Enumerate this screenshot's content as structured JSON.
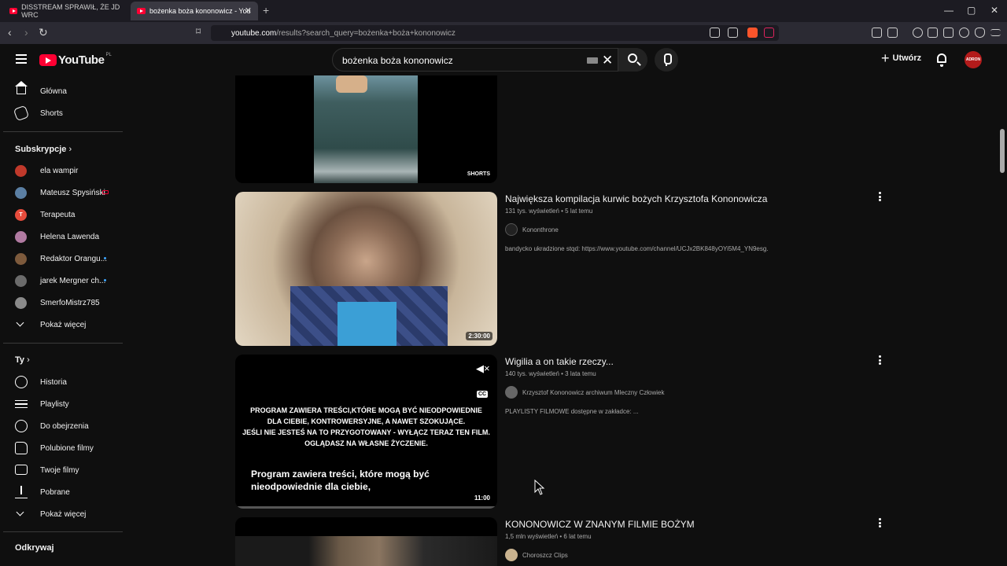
{
  "browser": {
    "tabs": [
      {
        "label": "DISSTREAM SPRAWIŁ, ŻE JD WRC"
      },
      {
        "label": "bożenka boża kononowicz - You"
      }
    ],
    "new_tab": "+",
    "url_host": "youtube.com",
    "url_path": "/results?search_query=bożenka+boża+kononowicz",
    "window_controls": [
      "—",
      "▢",
      "✕"
    ]
  },
  "header": {
    "logo_text": "YouTube",
    "region": "PL",
    "search_value": "bożenka boża kononowicz",
    "create_label": "Utwórz",
    "avatar_text": "ADRON"
  },
  "sidebar": {
    "main": [
      {
        "label": "Główna",
        "icon": "home-icon"
      },
      {
        "label": "Shorts",
        "icon": "shorts-icon"
      }
    ],
    "subs_heading": "Subskrypcje",
    "subs": [
      {
        "label": "ela wampir",
        "color": "#c0392b",
        "initial": ""
      },
      {
        "label": "Mateusz Spysiński",
        "color": "#5b7fa3",
        "initial": ""
      },
      {
        "label": "Terapeuta",
        "color": "#e74c3c",
        "initial": "T"
      },
      {
        "label": "Helena Lawenda",
        "color": "#b07aa1",
        "initial": ""
      },
      {
        "label": "Redaktor Orangu...",
        "color": "#7d5a3c",
        "initial": ""
      },
      {
        "label": "jarek Mergner ch...",
        "color": "#6b6b6b",
        "initial": ""
      },
      {
        "label": "SmerfoMistrz785",
        "color": "#8a8a8a",
        "initial": ""
      }
    ],
    "subs_more": "Pokaż więcej",
    "you_heading": "Ty",
    "you": [
      {
        "label": "Historia",
        "icon": "history-icon"
      },
      {
        "label": "Playlisty",
        "icon": "playlist-icon"
      },
      {
        "label": "Do obejrzenia",
        "icon": "clock-icon"
      },
      {
        "label": "Polubione filmy",
        "icon": "thumbs-up-icon"
      },
      {
        "label": "Twoje filmy",
        "icon": "video-icon"
      },
      {
        "label": "Pobrane",
        "icon": "download-icon"
      }
    ],
    "you_more": "Pokaż więcej",
    "explore_heading": "Odkrywaj"
  },
  "results": [
    {
      "kind": "short",
      "badge": "SHORTS"
    },
    {
      "title": "Największa kompilacja kurwic bożych Krzysztofa Kononowicza",
      "views": "131 tys. wyświetleń",
      "age": "5 lat temu",
      "channel": "Kononthrone",
      "description": "bandycko ukradzione stqd: https://www.youtube.com/channel/UCJx2BK848yOYi5M4_YN9esg.",
      "duration": "2:30:00"
    },
    {
      "title": "Wigilia a on takie rzeczy...",
      "views": "140 tys. wyświetleń",
      "age": "3 lata temu",
      "channel": "Krzysztof Kononowicz archiwum Mleczny Człowiek",
      "description": "PLAYLISTY FILMOWE dostępne w zakładce: ...",
      "duration": "11:00",
      "warning_lines": [
        "PROGRAM ZAWIERA TREŚCI,KTÓRE MOGĄ BYĆ NIEODPOWIEDNIE",
        "DLA CIEBIE, KONTROWERSYJNE, A NAWET SZOKUJĄCE.",
        "JEŚLI NIE JESTEŚ NA TO PRZYGOTOWANY - WYŁĄCZ TERAZ TEN FILM.",
        "OGLĄDASZ NA WŁASNE ŻYCZENIE."
      ],
      "subtitle_lines": [
        "Program zawiera treści, które mogą być",
        "nieodpowiednie dla ciebie,"
      ],
      "cc_label": "CC"
    },
    {
      "title": "KONONOWICZ W ZNANYM FILMIE BOŻYM",
      "views": "1,5 mln wyświetleń",
      "age": "6 lat temu",
      "channel": "Choroszcz Clips"
    }
  ],
  "colors": {
    "background": "#0f0f0f",
    "brand_red": "#ff0033",
    "text_secondary": "#aaaaaa"
  }
}
